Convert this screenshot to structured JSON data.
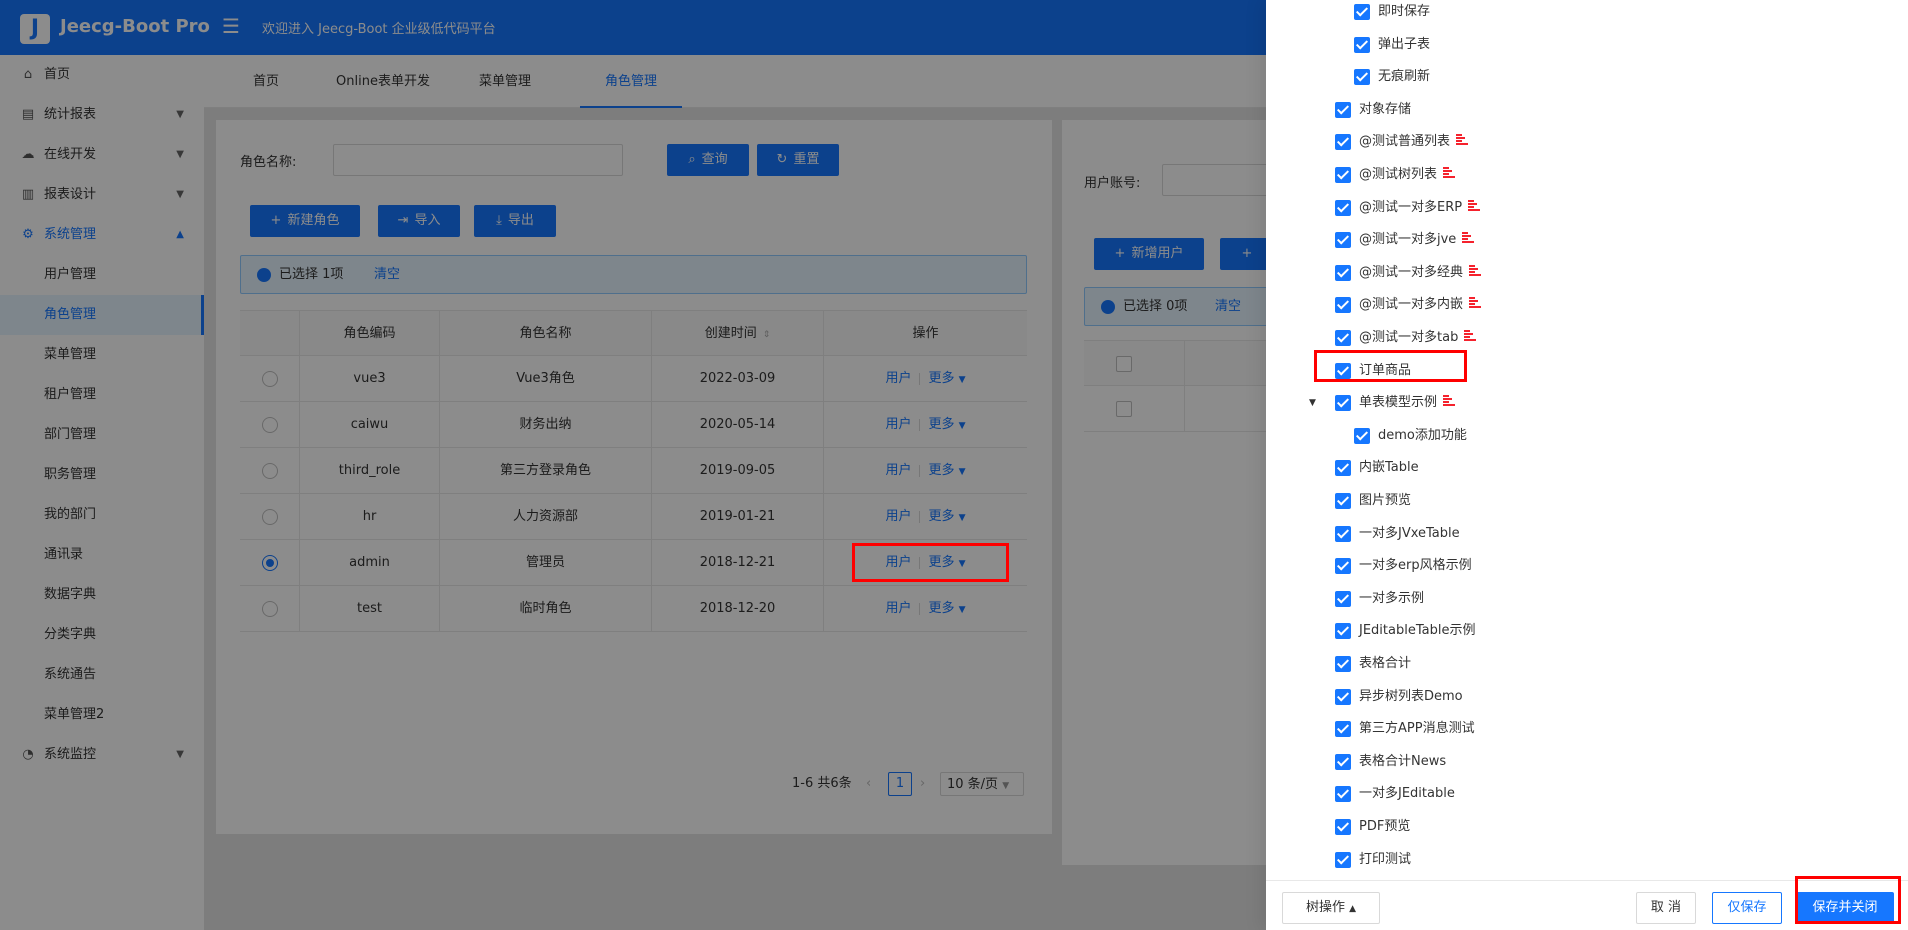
{
  "header": {
    "logo_letter": "J",
    "app_title": "Jeecg-Boot Pro",
    "welcome": "欢迎进入 Jeecg-Boot 企业级低代码平台",
    "menu_fold_icon": "menu-fold-icon"
  },
  "sidebar": {
    "items": [
      {
        "label": "首页",
        "icon": "home-icon"
      },
      {
        "label": "统计报表",
        "icon": "bar-chart-icon"
      },
      {
        "label": "在线开发",
        "icon": "cloud-icon"
      },
      {
        "label": "报表设计",
        "icon": "area-chart-icon"
      },
      {
        "label": "系统管理",
        "icon": "gear-icon"
      },
      {
        "label": "用户管理"
      },
      {
        "label": "角色管理"
      },
      {
        "label": "菜单管理"
      },
      {
        "label": "租户管理"
      },
      {
        "label": "部门管理"
      },
      {
        "label": "职务管理"
      },
      {
        "label": "我的部门"
      },
      {
        "label": "通讯录"
      },
      {
        "label": "数据字典"
      },
      {
        "label": "分类字典"
      },
      {
        "label": "系统通告"
      },
      {
        "label": "菜单管理2"
      },
      {
        "label": "系统监控",
        "icon": "dashboard-icon"
      }
    ],
    "active": "角色管理"
  },
  "tabs": [
    "首页",
    "Online表单开发",
    "菜单管理",
    "角色管理"
  ],
  "role_panel": {
    "search_label": "角色名称:",
    "query_button": "查询",
    "reset_button": "重置",
    "new_button": "新建角色",
    "import_button": "导入",
    "export_button": "导出",
    "selected_text": "已选择 1项",
    "clear_text": "清空",
    "columns": [
      "角色编码",
      "角色名称",
      "创建时间",
      "操作"
    ],
    "rows": [
      {
        "code": "vue3",
        "name": "Vue3角色",
        "created": "2022-03-09",
        "selected": false
      },
      {
        "code": "caiwu",
        "name": "财务出纳",
        "created": "2020-05-14",
        "selected": false
      },
      {
        "code": "third_role",
        "name": "第三方登录角色",
        "created": "2019-09-05",
        "selected": false
      },
      {
        "code": "hr",
        "name": "人力资源部",
        "created": "2019-01-21",
        "selected": false
      },
      {
        "code": "admin",
        "name": "管理员",
        "created": "2018-12-21",
        "selected": true
      },
      {
        "code": "test",
        "name": "临时角色",
        "created": "2018-12-20",
        "selected": false
      }
    ],
    "op_user": "用户",
    "op_more": "更多",
    "pagination": {
      "total": "1-6 共6条",
      "current": "1",
      "page_size": "10 条/页"
    }
  },
  "user_panel": {
    "account_label": "用户账号:",
    "new_user_button": "新增用户",
    "selected_text": "已选择 0项",
    "clear_text": "清空"
  },
  "drawer": {
    "tree": [
      {
        "label": "即时保存",
        "level": 2,
        "badge": false
      },
      {
        "label": "弹出子表",
        "level": 2,
        "badge": false
      },
      {
        "label": "无痕刷新",
        "level": 2,
        "badge": false
      },
      {
        "label": "对象存储",
        "level": 1,
        "badge": false
      },
      {
        "label": "@测试普通列表",
        "level": 1,
        "badge": true
      },
      {
        "label": "@测试树列表",
        "level": 1,
        "badge": true
      },
      {
        "label": "@测试一对多ERP",
        "level": 1,
        "badge": true
      },
      {
        "label": "@测试一对多jve",
        "level": 1,
        "badge": true
      },
      {
        "label": "@测试一对多经典",
        "level": 1,
        "badge": true
      },
      {
        "label": "@测试一对多内嵌",
        "level": 1,
        "badge": true
      },
      {
        "label": "@测试一对多tab",
        "level": 1,
        "badge": true
      },
      {
        "label": "订单商品",
        "level": 1,
        "badge": false
      },
      {
        "label": "单表模型示例",
        "level": 1,
        "badge": true,
        "expanded": true
      },
      {
        "label": "demo添加功能",
        "level": 2,
        "badge": false
      },
      {
        "label": "内嵌Table",
        "level": 1,
        "badge": false
      },
      {
        "label": "图片预览",
        "level": 1,
        "badge": false
      },
      {
        "label": "一对多JVxeTable",
        "level": 1,
        "badge": false
      },
      {
        "label": "一对多erp风格示例",
        "level": 1,
        "badge": false
      },
      {
        "label": "一对多示例",
        "level": 1,
        "badge": false
      },
      {
        "label": "JEditableTable示例",
        "level": 1,
        "badge": false
      },
      {
        "label": "表格合计",
        "level": 1,
        "badge": false
      },
      {
        "label": "异步树列表Demo",
        "level": 1,
        "badge": false
      },
      {
        "label": "第三方APP消息测试",
        "level": 1,
        "badge": false
      },
      {
        "label": "表格合计News",
        "level": 1,
        "badge": false
      },
      {
        "label": "一对多JEditable",
        "level": 1,
        "badge": false
      },
      {
        "label": "PDF预览",
        "level": 1,
        "badge": false
      },
      {
        "label": "打印测试",
        "level": 1,
        "badge": false
      }
    ],
    "footer": {
      "tree_ops": "树操作",
      "cancel": "取 消",
      "save_only": "仅保存",
      "save_close": "保存并关闭"
    }
  },
  "colors": {
    "primary": "#1677ff",
    "annotation": "#ff0000"
  }
}
